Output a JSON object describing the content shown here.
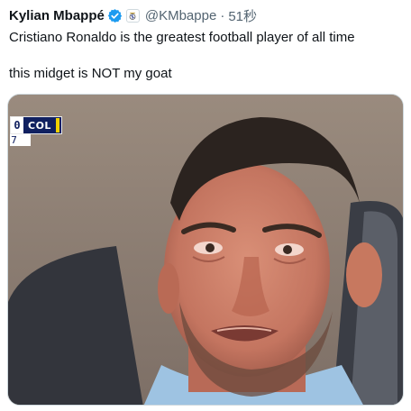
{
  "tweet": {
    "author_name": "Kylian Mbappé",
    "handle": "@KMbappe",
    "separator": "·",
    "time": "51秒",
    "line1": "Cristiano Ronaldo is the greatest football player of all time",
    "line2": "this midget is NOT my goat"
  },
  "media": {
    "scoreboard": {
      "score": "0",
      "team": "COL",
      "clock": "7"
    }
  },
  "colors": {
    "verified_blue": "#1d9bf0",
    "text": "#0f1419",
    "muted": "#536471",
    "scoreboard_navy": "#102060",
    "scoreboard_accent": "#f0d000"
  },
  "icons": {
    "verified": "verified-badge-icon",
    "affiliate": "real-madrid-crest-icon"
  }
}
